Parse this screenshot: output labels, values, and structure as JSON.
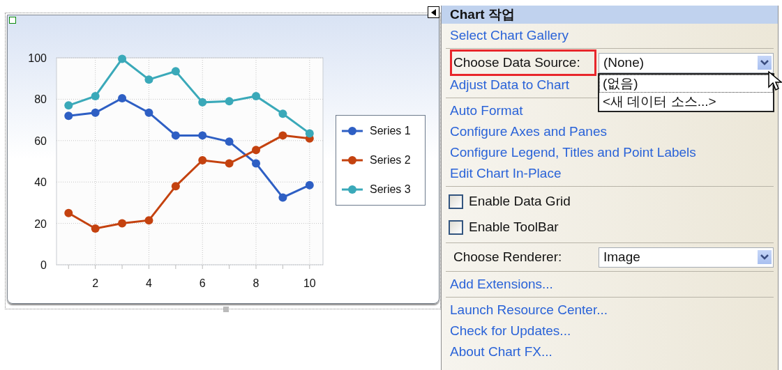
{
  "chart": {
    "chart_data": {
      "type": "line",
      "grid": true,
      "x": [
        1,
        2,
        3,
        4,
        5,
        6,
        7,
        8,
        9,
        10
      ],
      "xlim": [
        0.55,
        10.5
      ],
      "ylim": [
        0,
        100
      ],
      "xticks": [
        2,
        4,
        6,
        8,
        10
      ],
      "yticks": [
        0,
        20,
        40,
        60,
        80,
        100
      ],
      "series": [
        {
          "name": "Series 1",
          "color": "#2e5fc4",
          "marker": "circle",
          "values": [
            72,
            73.5,
            80.5,
            73.5,
            62.5,
            62.5,
            59.5,
            49,
            32.5,
            38.5
          ]
        },
        {
          "name": "Series 2",
          "color": "#c4420f",
          "marker": "circle",
          "values": [
            25,
            17.5,
            20,
            21.5,
            38,
            50.5,
            49,
            55.5,
            62.5,
            61
          ]
        },
        {
          "name": "Series 3",
          "color": "#3aa9b9",
          "marker": "circle",
          "values": [
            77,
            81.5,
            99.5,
            89.5,
            93.5,
            78.5,
            79,
            81.5,
            73,
            63.5
          ]
        }
      ]
    }
  },
  "panel": {
    "title": "Chart 작업",
    "sections": [
      [
        {
          "kind": "link",
          "label": "Select Chart Gallery"
        }
      ],
      [
        {
          "kind": "dropdown",
          "label": "Choose Data Source:",
          "value": "(None)",
          "highlighted": true,
          "options": [
            {
              "label": "(없음)",
              "selected": true
            },
            {
              "label": "<새 데이터 소스...>",
              "selected": false
            }
          ]
        },
        {
          "kind": "link",
          "label": "Adjust Data to Chart"
        }
      ],
      [
        {
          "kind": "link",
          "label": "Auto Format"
        },
        {
          "kind": "link",
          "label": "Configure Axes and Panes"
        },
        {
          "kind": "link",
          "label": "Configure Legend, Titles and Point Labels"
        },
        {
          "kind": "link",
          "label": "Edit Chart In-Place"
        }
      ],
      [
        {
          "kind": "checkbox",
          "label": "Enable Data Grid",
          "checked": false
        },
        {
          "kind": "checkbox",
          "label": "Enable ToolBar",
          "checked": false
        }
      ],
      [
        {
          "kind": "dropdown",
          "label": "Choose Renderer:",
          "value": "Image",
          "highlighted": false
        }
      ],
      [
        {
          "kind": "link",
          "label": "Add Extensions..."
        }
      ],
      [
        {
          "kind": "link",
          "label": "Launch Resource Center..."
        },
        {
          "kind": "link",
          "label": "Check for Updates..."
        },
        {
          "kind": "link",
          "label": "About Chart FX..."
        }
      ]
    ]
  }
}
